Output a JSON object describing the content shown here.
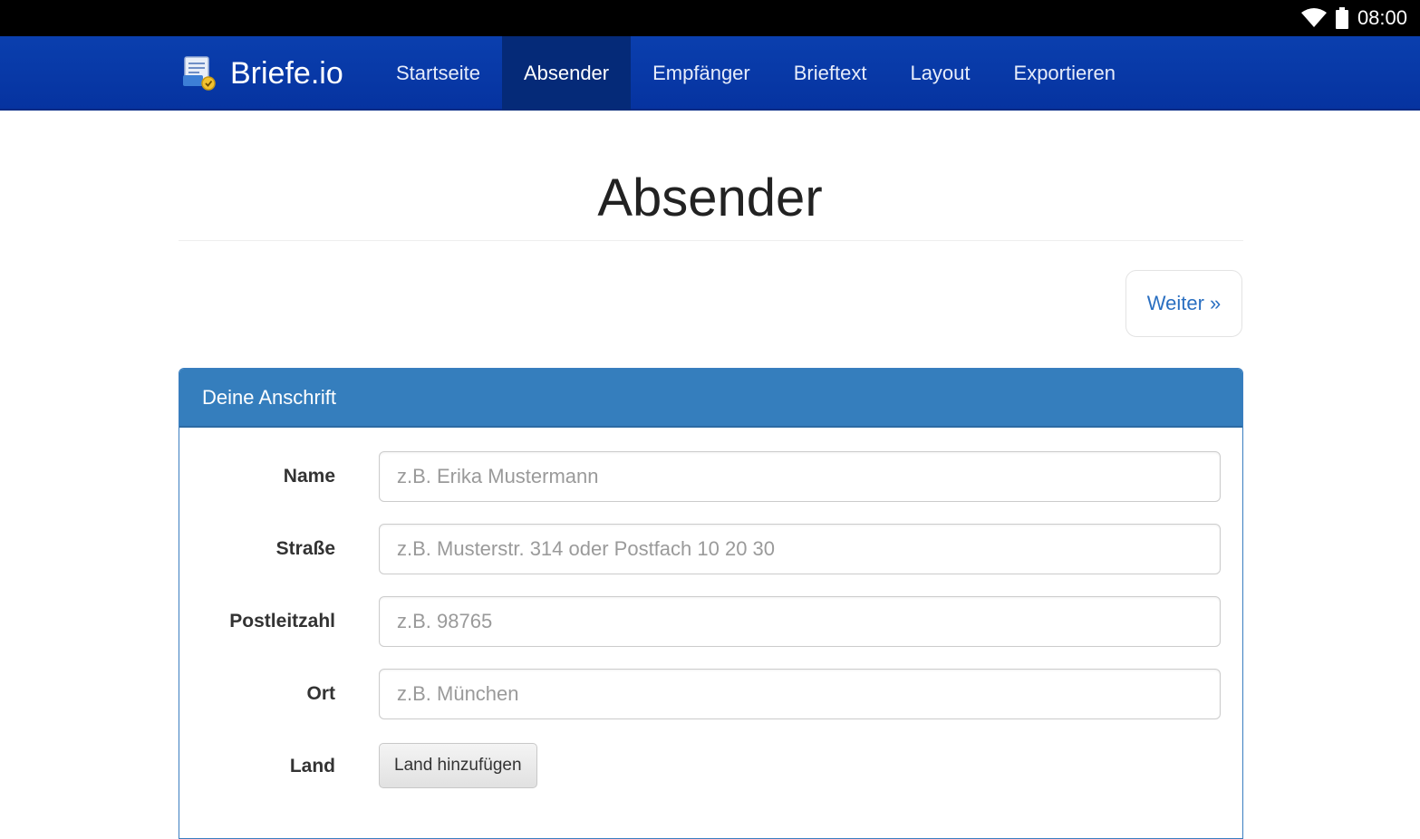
{
  "status_bar": {
    "time": "08:00"
  },
  "navbar": {
    "brand": "Briefe.io",
    "items": [
      {
        "label": "Startseite",
        "active": false
      },
      {
        "label": "Absender",
        "active": true
      },
      {
        "label": "Empfänger",
        "active": false
      },
      {
        "label": "Brieftext",
        "active": false
      },
      {
        "label": "Layout",
        "active": false
      },
      {
        "label": "Exportieren",
        "active": false
      }
    ]
  },
  "main": {
    "title": "Absender",
    "next_label": "Weiter »"
  },
  "panel": {
    "heading": "Deine Anschrift",
    "fields": [
      {
        "label": "Name",
        "placeholder": "z.B. Erika Mustermann",
        "value": ""
      },
      {
        "label": "Straße",
        "placeholder": "z.B. Musterstr. 314 oder Postfach 10 20 30",
        "value": ""
      },
      {
        "label": "Postleitzahl",
        "placeholder": "z.B. 98765",
        "value": ""
      },
      {
        "label": "Ort",
        "placeholder": "z.B. München",
        "value": ""
      }
    ],
    "land": {
      "label": "Land",
      "button_label": "Land hinzufügen"
    }
  },
  "colors": {
    "navbar": "#0a3fae",
    "navbar_active": "#052a78",
    "panel_heading": "#357ebd",
    "link": "#2a6fc1"
  }
}
